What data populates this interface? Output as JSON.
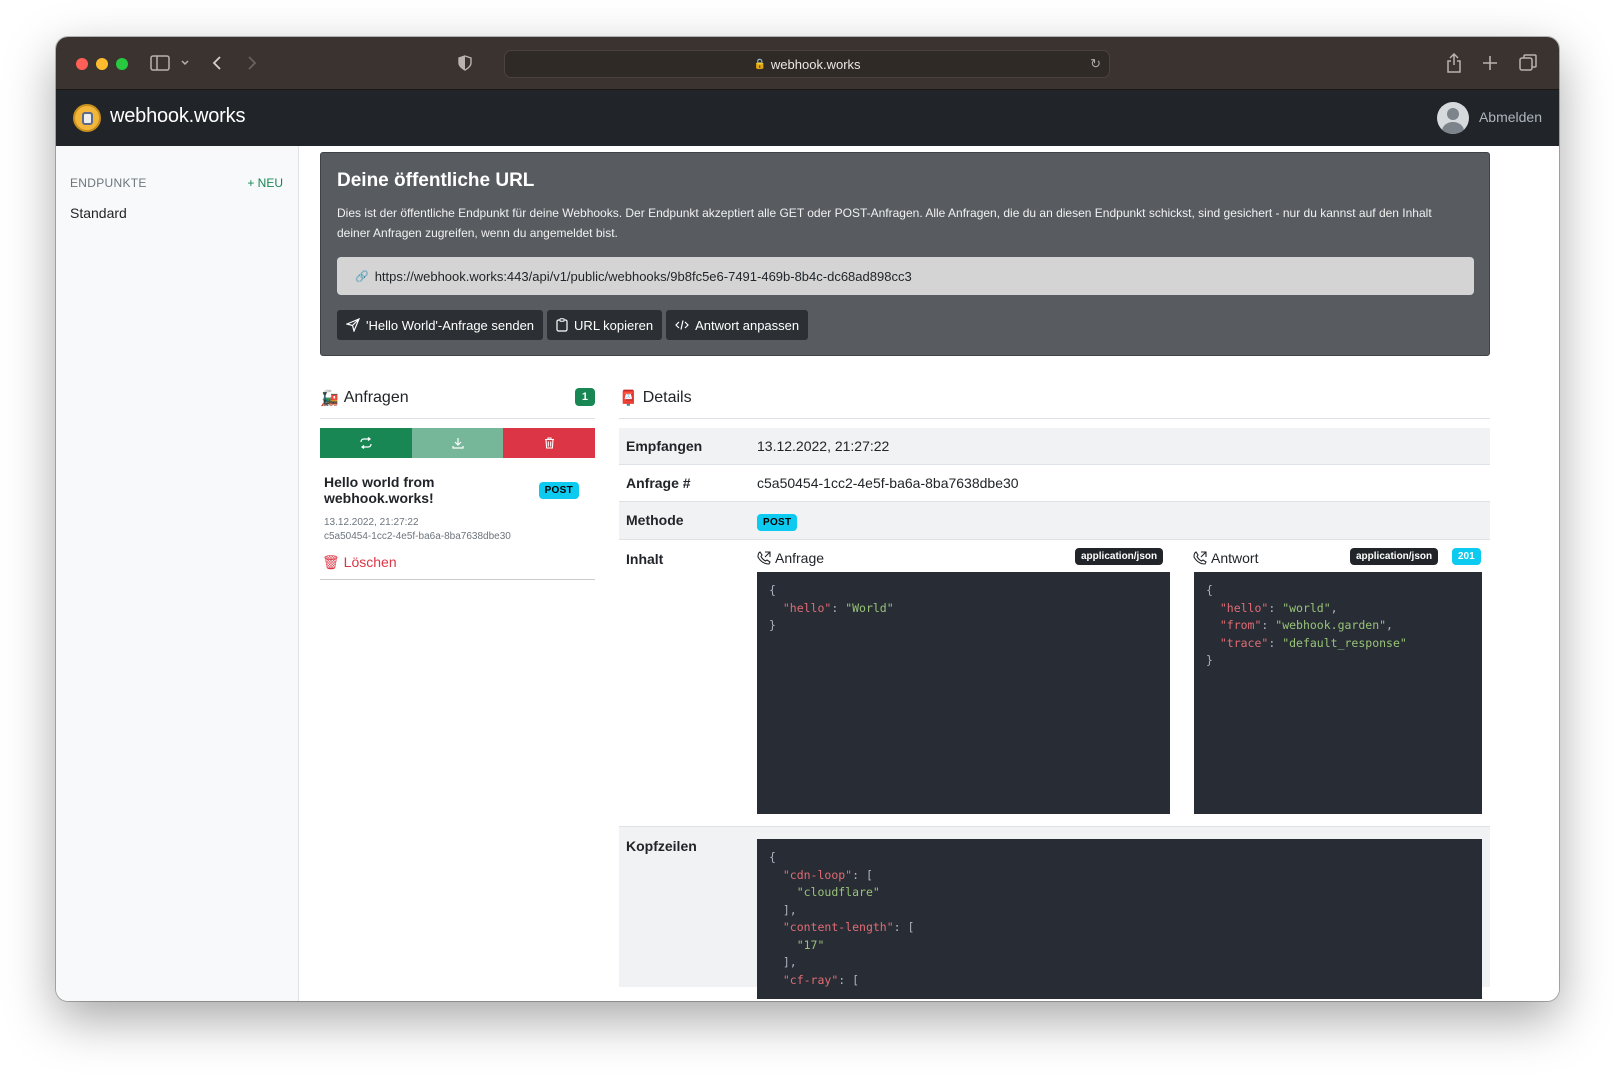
{
  "browser": {
    "address": "webhook.works"
  },
  "app": {
    "brand": "webhook.works",
    "logout": "Abmelden"
  },
  "sidebar": {
    "heading": "ENDPUNKTE",
    "new_label": "+ NEU",
    "items": [
      {
        "label": "Standard"
      }
    ]
  },
  "url_card": {
    "title": "Deine öffentliche URL",
    "description": "Dies ist der öffentliche Endpunkt für deine Webhooks. Der Endpunkt akzeptiert alle GET oder POST-Anfragen. Alle Anfragen, die du an diesen Endpunkt schickst, sind gesichert - nur du kannst auf den Inhalt deiner Anfragen zugreifen, wenn du angemeldet bist.",
    "url": "https://webhook.works:443/api/v1/public/webhooks/9b8fc5e6-7491-469b-8b4c-dc68ad898cc3",
    "buttons": {
      "send": "'Hello World'-Anfrage senden",
      "copy": "URL kopieren",
      "customize": "Antwort anpassen"
    }
  },
  "requests": {
    "title": "Anfragen",
    "count": "1",
    "items": [
      {
        "title": "Hello world from webhook.works!",
        "method": "POST",
        "timestamp": "13.12.2022, 21:27:22",
        "id": "c5a50454-1cc2-4e5f-ba6a-8ba7638dbe30",
        "delete_label": "Löschen"
      }
    ]
  },
  "details": {
    "title": "Details",
    "rows": {
      "received": {
        "label": "Empfangen",
        "value": "13.12.2022, 21:27:22"
      },
      "request_no": {
        "label": "Anfrage #",
        "value": "c5a50454-1cc2-4e5f-ba6a-8ba7638dbe30"
      },
      "method": {
        "label": "Methode",
        "value": "POST"
      },
      "content": {
        "label": "Inhalt"
      },
      "headers": {
        "label": "Kopfzeilen"
      }
    },
    "request_panel": {
      "title": "Anfrage",
      "content_type": "application/json",
      "body": "{\n  \"hello\": \"World\"\n}"
    },
    "response_panel": {
      "title": "Antwort",
      "content_type": "application/json",
      "status": "201",
      "body": "{\n  \"hello\": \"world\",\n  \"from\": \"webhook.garden\",\n  \"trace\": \"default_response\"\n}"
    },
    "headers_body": "{\n  \"cdn-loop\": [\n    \"cloudflare\"\n  ],\n  \"content-length\": [\n    \"17\"\n  ],\n  \"cf-ray\": ["
  }
}
